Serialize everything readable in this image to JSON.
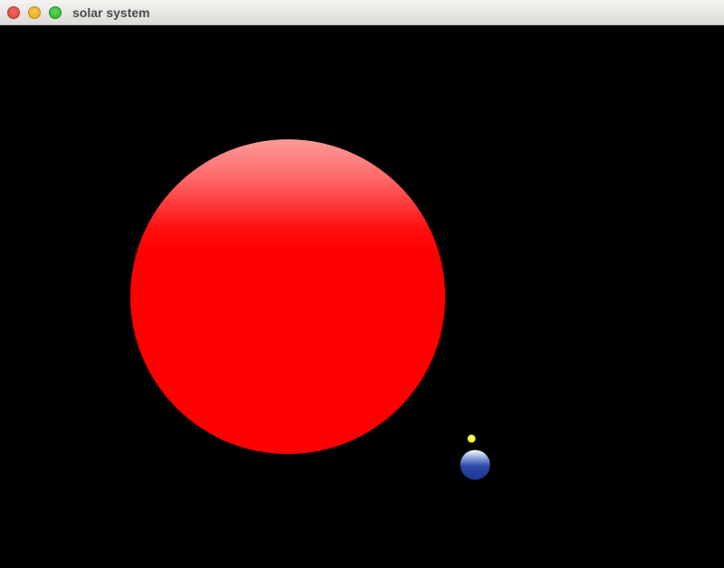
{
  "window": {
    "title": "solar system"
  },
  "scene": {
    "background": "#000000",
    "bodies": [
      {
        "name": "sun",
        "color": "#ff0000"
      },
      {
        "name": "earth",
        "color": "#1f3a9a"
      },
      {
        "name": "moon",
        "color": "#ffff00"
      }
    ]
  }
}
